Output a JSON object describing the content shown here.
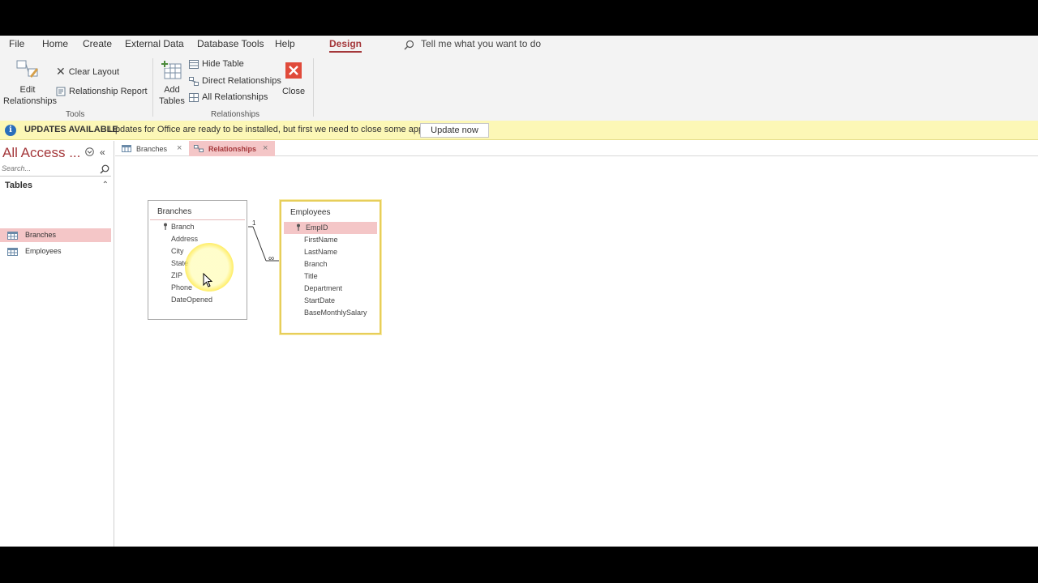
{
  "menu": {
    "items": [
      "File",
      "Home",
      "Create",
      "External Data",
      "Database Tools",
      "Help",
      "Design"
    ],
    "active": "Design",
    "tell_me": "Tell me what you want to do"
  },
  "ribbon": {
    "edit_relationships": [
      "Edit",
      "Relationships"
    ],
    "clear_layout": "Clear Layout",
    "relationship_report": "Relationship Report",
    "tools_group": "Tools",
    "add_tables": [
      "Add",
      "Tables"
    ],
    "hide_table": "Hide Table",
    "direct_relationships": "Direct Relationships",
    "all_relationships": "All Relationships",
    "relationships_group": "Relationships",
    "close": "Close"
  },
  "update_bar": {
    "title": "UPDATES AVAILABLE",
    "message": "Updates for Office are ready to be installed, but first we need to close some apps.",
    "button": "Update now"
  },
  "nav": {
    "title": "All Access ...",
    "search_placeholder": "Search...",
    "section": "Tables",
    "items": [
      {
        "label": "Branches",
        "selected": true
      },
      {
        "label": "Employees",
        "selected": false
      }
    ]
  },
  "tabs": [
    {
      "label": "Branches",
      "active": false
    },
    {
      "label": "Relationships",
      "active": true
    }
  ],
  "tables": {
    "branches": {
      "title": "Branches",
      "fields": [
        "Branch",
        "Address",
        "City",
        "State",
        "ZIP",
        "Phone",
        "DateOpened"
      ],
      "key_field": "Branch"
    },
    "employees": {
      "title": "Employees",
      "fields": [
        "EmpID",
        "FirstName",
        "LastName",
        "Branch",
        "Title",
        "Department",
        "StartDate",
        "BaseMonthlySalary"
      ],
      "key_field": "EmpID"
    }
  },
  "relationship": {
    "one": "1",
    "many": "∞"
  },
  "colors": {
    "accent": "#a4373a",
    "selection": "#f4c6c7",
    "update_bar": "#fcf7b6"
  }
}
